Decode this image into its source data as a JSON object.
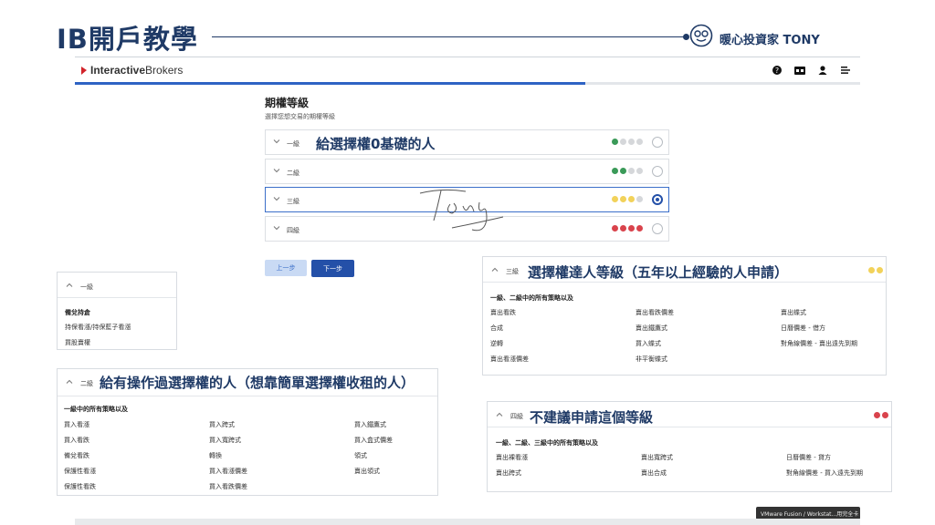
{
  "slide": {
    "title": "IB開戶教學",
    "brand": "暖心投資家 TONY"
  },
  "navbar": {
    "logo_prefix": "Interactive",
    "logo_suffix": "Brokers",
    "icons": [
      "help-icon",
      "language-icon",
      "user-icon",
      "menu-icon"
    ]
  },
  "progress": {
    "completed_fraction": 0.65,
    "fill_color": "#2e63c4"
  },
  "panel": {
    "title": "期權等級",
    "subtitle": "選擇您想交易的期權等級",
    "rows": [
      {
        "label": "一級",
        "annotation": "給選擇權0基礎的人",
        "dots": [
          "#3a9a58",
          "#d5d7da",
          "#d5d7da",
          "#d5d7da"
        ],
        "selected": false
      },
      {
        "label": "二級",
        "annotation": "",
        "dots": [
          "#3a9a58",
          "#3a9a58",
          "#d5d7da",
          "#d5d7da"
        ],
        "selected": false
      },
      {
        "label": "三級",
        "annotation": "",
        "dots": [
          "#f2d25a",
          "#f2d25a",
          "#f2d25a",
          "#d5d7da"
        ],
        "selected": true
      },
      {
        "label": "四級",
        "annotation": "",
        "dots": [
          "#d9434c",
          "#d9434c",
          "#d9434c",
          "#d9434c"
        ],
        "selected": false
      }
    ],
    "prev_label": "上一步",
    "next_label": "下一步"
  },
  "card_level1": {
    "level": "一級",
    "heading": "備兌持倉",
    "items": [
      "持保看漲/持保藍子看漲",
      "買股賣權"
    ]
  },
  "card_level2": {
    "level": "二級",
    "annotation": "給有操作過選擇權的人（想靠簡單選擇權收租的人）",
    "heading": "一級中的所有策略以及",
    "items": [
      "買入看漲",
      "買入跨式",
      "買入鐵鷹式",
      "買入看跌",
      "買入寬跨式",
      "買入盒式價差",
      "備兌看跌",
      "轉換",
      "領式",
      "保護性看漲",
      "買入看漲價差",
      "賣出領式",
      "保護性看跌",
      "買入看跌價差",
      ""
    ]
  },
  "card_level3": {
    "level": "三級",
    "annotation": "選擇權達人等級（五年以上經驗的人申請）",
    "dots": [
      "#f2d25a",
      "#f2d25a"
    ],
    "heading": "一級、二級中的所有策略以及",
    "items": [
      "賣出看跌",
      "賣出看跌價差",
      "賣出蝶式",
      "合成",
      "賣出鐵鷹式",
      "日曆價差 - 借方",
      "逆轉",
      "買入蝶式",
      "對角線價差 - 賣出遠先到期",
      "賣出看漲價差",
      "非平衡蝶式",
      ""
    ]
  },
  "card_level4": {
    "level": "四級",
    "annotation": "不建議申請這個等級",
    "dots": [
      "#d9434c",
      "#d9434c"
    ],
    "heading": "一級、二級、三級中的所有策略以及",
    "items": [
      "賣出裸看漲",
      "賣出寬跨式",
      "日曆價差 - 貸方",
      "賣出跨式",
      "賣出合成",
      "對角線價差 - 買入遠先到期"
    ]
  },
  "vm_tooltip": "VMware Fusion / Workstat...用完全卡"
}
